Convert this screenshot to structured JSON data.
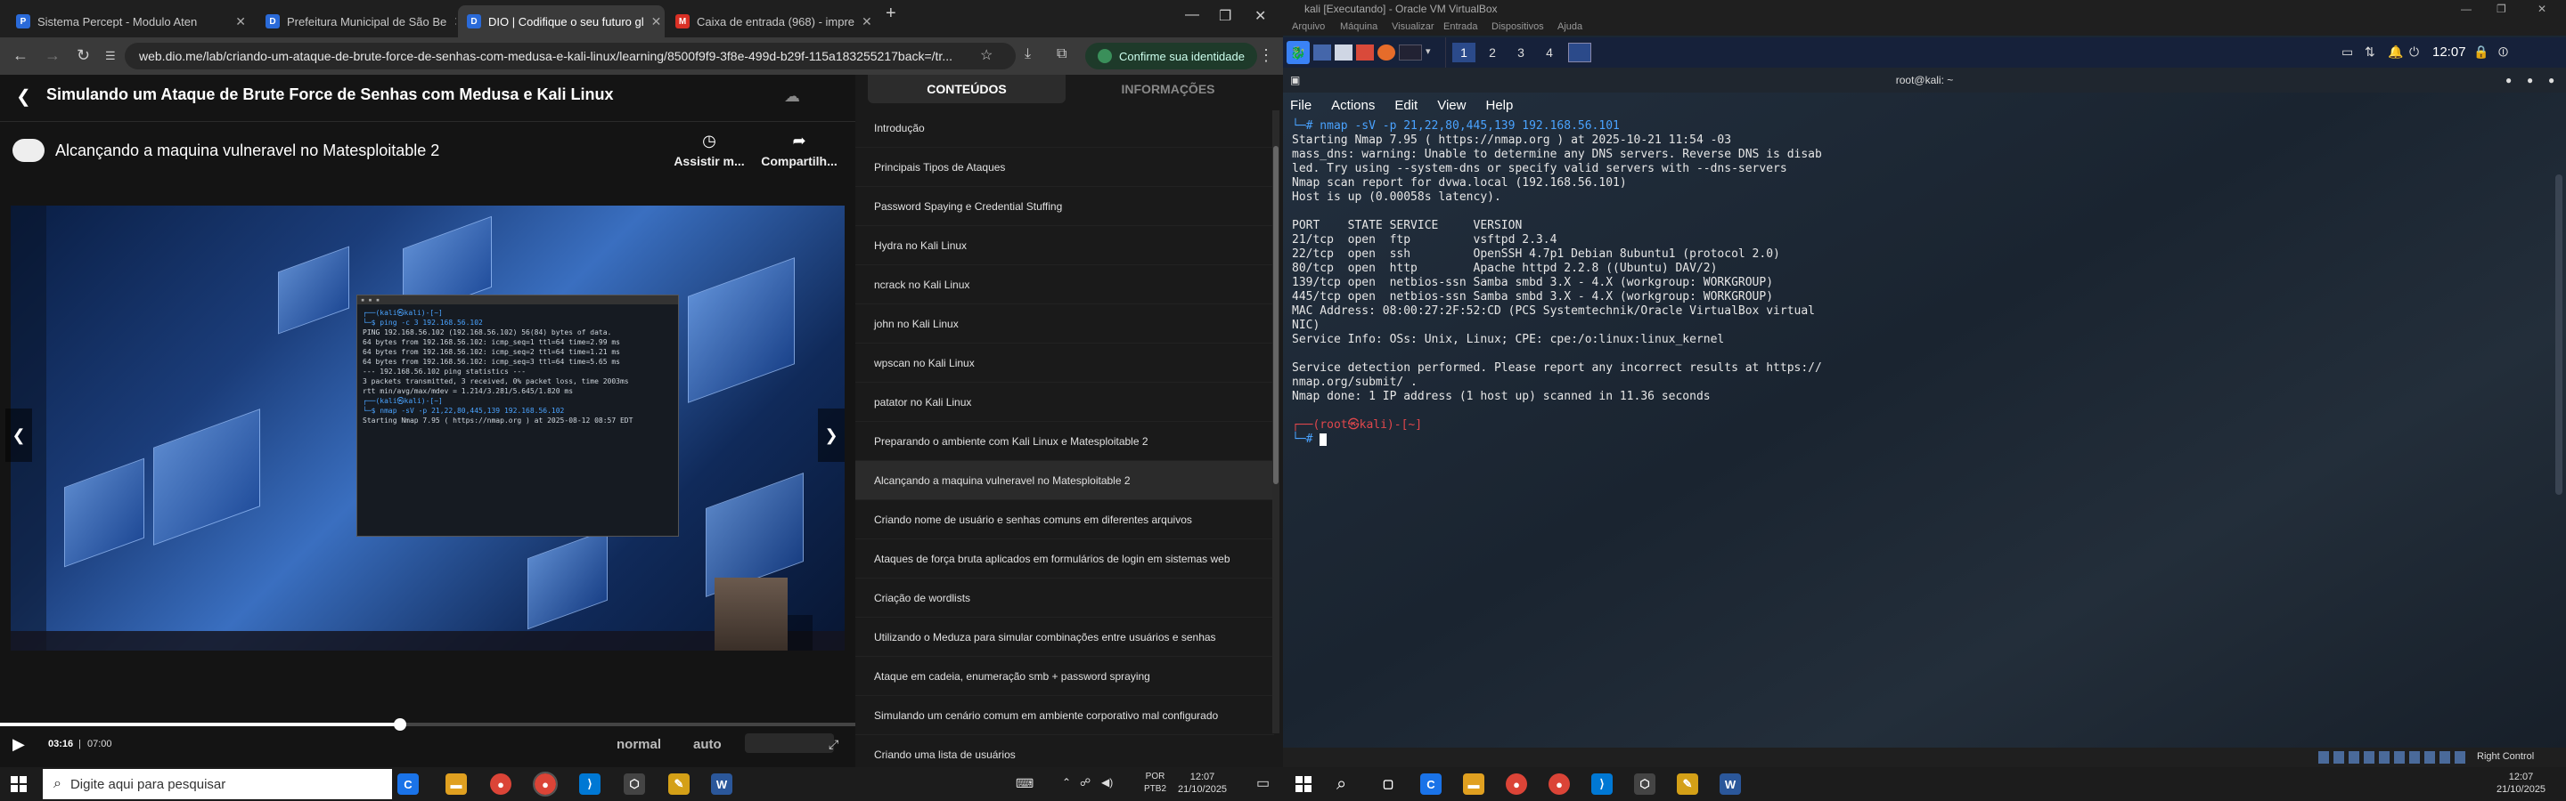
{
  "browser": {
    "tabs": [
      {
        "title": "Sistema Percept - Modulo Aten",
        "favicon": "P",
        "color": "#2a6ad8"
      },
      {
        "title": "Prefeitura Municipal de São Be",
        "favicon": "D",
        "color": "#2a6ad8"
      },
      {
        "title": "DIO | Codifique o seu futuro gl",
        "favicon": "D",
        "color": "#2a6ad8"
      },
      {
        "title": "Caixa de entrada (968) - impre",
        "favicon": "M",
        "color": "#d93025"
      }
    ],
    "new_tab": "+",
    "url": "web.dio.me/lab/criando-um-ataque-de-brute-force-de-senhas-com-medusa-e-kali-linux/learning/8500f9f9-3f8e-499d-b29f-115a183255217back=/tr...",
    "identity_label": "Confirme sua identidade"
  },
  "player": {
    "course_title": "Simulando um Ataque de Brute Force de Senhas com Medusa e Kali Linux",
    "lesson_title": "Alcançando a maquina vulneravel no Matesploitable 2",
    "actions": [
      {
        "label": "Assistir m..."
      },
      {
        "label": "Compartilh..."
      }
    ],
    "time_current": "03:16",
    "time_total": "07:00",
    "progress": 0.468,
    "speed": "normal",
    "quality": "auto",
    "video_terminal": [
      "┌──(kali㉿kali)-[~]",
      "└─$ ping -c 3 192.168.56.102",
      "PING 192.168.56.102 (192.168.56.102) 56(84) bytes of data.",
      "64 bytes from 192.168.56.102: icmp_seq=1 ttl=64 time=2.99 ms",
      "64 bytes from 192.168.56.102: icmp_seq=2 ttl=64 time=1.21 ms",
      "64 bytes from 192.168.56.102: icmp_seq=3 ttl=64 time=5.65 ms",
      "",
      "--- 192.168.56.102 ping statistics ---",
      "3 packets transmitted, 3 received, 0% packet loss, time 2003ms",
      "rtt min/avg/max/mdev = 1.214/3.281/5.645/1.820 ms",
      "",
      "┌──(kali㉿kali)-[~]",
      "└─$ nmap -sV -p 21,22,80,445,139 192.168.56.102",
      "Starting Nmap 7.95 ( https://nmap.org ) at 2025-08-12 08:57 EDT"
    ]
  },
  "sidebar": {
    "tabs": [
      "CONTEÚDOS",
      "INFORMAÇÕES"
    ],
    "lessons": [
      "Introdução",
      "Principais Tipos de Ataques",
      "Password Spaying e Credential Stuffing",
      "Hydra no Kali Linux",
      "ncrack no Kali Linux",
      "john no Kali Linux",
      "wpscan no Kali Linux",
      "patator no Kali Linux",
      "Preparando o ambiente com Kali Linux e Matesploitable 2",
      "Alcançando a maquina vulneravel no Matesploitable 2",
      "Criando nome de usuário e senhas comuns em diferentes arquivos",
      "Ataques de força bruta aplicados em formulários de login em sistemas web",
      "Criação de wordlists",
      "Utilizando o Meduza para simular combinações entre usuários e senhas",
      "Ataque em cadeia, enumeração smb + password spraying",
      "Simulando um cenário comum em ambiente corporativo mal configurado",
      "Criando uma lista de usuários"
    ],
    "active_index": 9
  },
  "taskbar_left": {
    "search_placeholder": "Digite aqui para pesquisar",
    "lang": "POR",
    "layout": "PTB2",
    "time": "12:07",
    "date": "21/10/2025"
  },
  "vm": {
    "title": "kali [Executando] - Oracle VM VirtualBox",
    "menu": [
      "Arquivo",
      "Máquina",
      "Visualizar",
      "Entrada",
      "Dispositivos",
      "Ajuda"
    ],
    "workspaces": [
      "1",
      "2",
      "3",
      "4"
    ],
    "clock": "12:07",
    "terminal_title": "root@kali: ~",
    "terminal_menu": [
      "File",
      "Actions",
      "Edit",
      "View",
      "Help"
    ],
    "terminal_lines": [
      "└─# nmap -sV -p 21,22,80,445,139 192.168.56.101",
      "Starting Nmap 7.95 ( https://nmap.org ) at 2025-10-21 11:54 -03",
      "mass_dns: warning: Unable to determine any DNS servers. Reverse DNS is disab",
      "led. Try using --system-dns or specify valid servers with --dns-servers",
      "Nmap scan report for dvwa.local (192.168.56.101)",
      "Host is up (0.00058s latency).",
      "",
      "PORT    STATE SERVICE     VERSION",
      "21/tcp  open  ftp         vsftpd 2.3.4",
      "22/tcp  open  ssh         OpenSSH 4.7p1 Debian 8ubuntu1 (protocol 2.0)",
      "80/tcp  open  http        Apache httpd 2.2.8 ((Ubuntu) DAV/2)",
      "139/tcp open  netbios-ssn Samba smbd 3.X - 4.X (workgroup: WORKGROUP)",
      "445/tcp open  netbios-ssn Samba smbd 3.X - 4.X (workgroup: WORKGROUP)",
      "MAC Address: 08:00:27:2F:52:CD (PCS Systemtechnik/Oracle VirtualBox virtual",
      "NIC)",
      "Service Info: OSs: Unix, Linux; CPE: cpe:/o:linux:linux_kernel",
      "",
      "Service detection performed. Please report any incorrect results at https://",
      "nmap.org/submit/ .",
      "Nmap done: 1 IP address (1 host up) scanned in 11.36 seconds",
      "",
      "┌──(root㉿kali)-[~]",
      "└─# "
    ],
    "status_right": "Right Control"
  },
  "taskbar_right": {
    "time": "12:07",
    "date": "21/10/2025"
  }
}
